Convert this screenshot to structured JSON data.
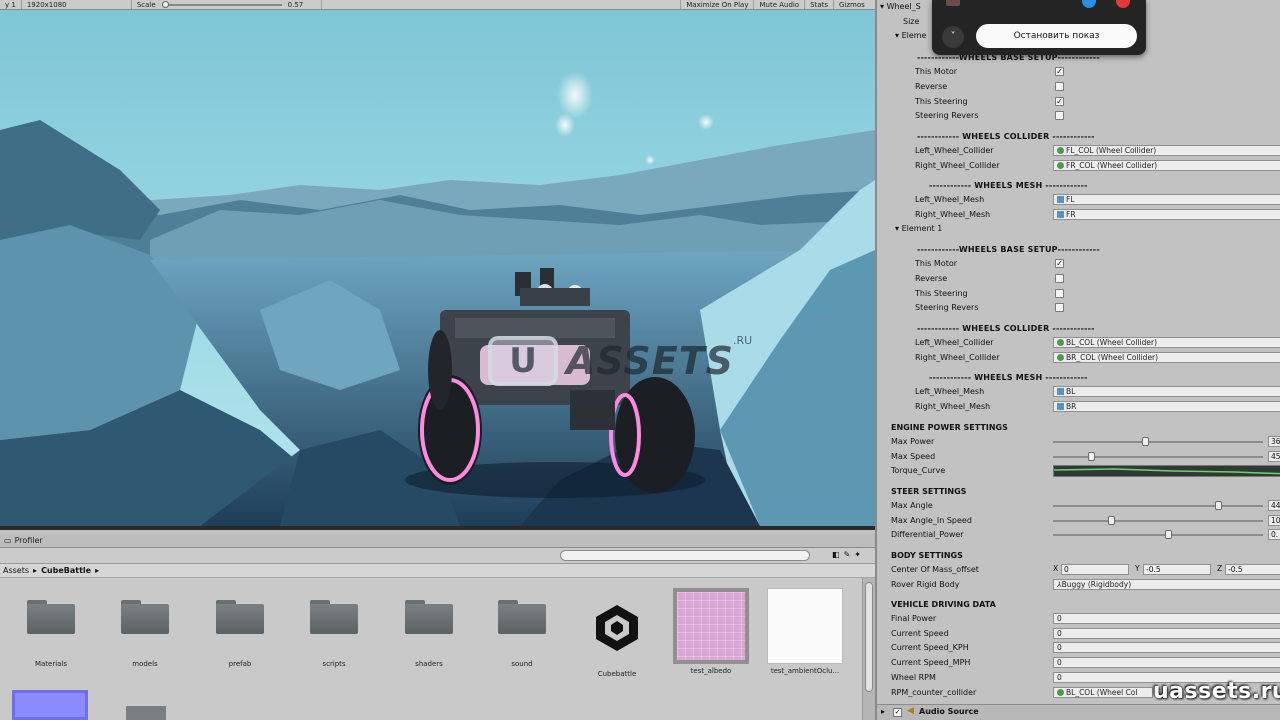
{
  "game_toolbar": {
    "display": "y 1",
    "resolution": "1920x1080",
    "scale_label": "Scale",
    "scale_value": "0.57",
    "maximize_on_play": "Maximize On Play",
    "mute_audio": "Mute Audio",
    "stats": "Stats",
    "gizmos": "Gizmos"
  },
  "game_view": {
    "watermark_letter": "U",
    "watermark_text": "ASSETS",
    "watermark_suffix": ".RU"
  },
  "profiler_tab": "Profiler",
  "project": {
    "breadcrumb_root": "Assets",
    "breadcrumb_sep": "▸",
    "breadcrumb_current": "CubeBattle",
    "assets": [
      {
        "label": "Materials",
        "kind": "folder"
      },
      {
        "label": "models",
        "kind": "folder"
      },
      {
        "label": "prefab",
        "kind": "folder"
      },
      {
        "label": "scripts",
        "kind": "folder"
      },
      {
        "label": "shaders",
        "kind": "folder"
      },
      {
        "label": "sound",
        "kind": "folder"
      },
      {
        "label": "Cubebattle",
        "kind": "unity-scene"
      },
      {
        "label": "test_albedo",
        "kind": "texture-pink"
      },
      {
        "label": "test_ambientOclu...",
        "kind": "texture-white"
      }
    ]
  },
  "inspector": {
    "top_label": "Wheel_S",
    "size_label": "Size",
    "element_label": "Eleme",
    "element1_label": "Element 1",
    "wheels_base_setup": "WHEELS BASE SETUP",
    "this_motor": "This Motor",
    "reverse": "Reverse",
    "this_steering": "This Steering",
    "steering_revers": "Steering Revers",
    "wheels_collider": "WHEELS COLLIDER",
    "left_wheel_collider": "Left_Wheel_Collider",
    "right_wheel_collider": "Right_Wheel_Collider",
    "wheels_mesh": "WHEELS MESH",
    "left_wheel_mesh": "Left_Wheel_Mesh",
    "right_wheel_mesh": "Right_Wheel_Mesh",
    "e0": {
      "this_motor": true,
      "reverse": false,
      "this_steering": true,
      "steering_revers": false,
      "left_collider": "FL_COL (Wheel Collider)",
      "right_collider": "FR_COL (Wheel Collider)",
      "left_mesh": "FL",
      "right_mesh": "FR"
    },
    "e1": {
      "this_motor": true,
      "reverse": false,
      "this_steering": false,
      "steering_revers": false,
      "left_collider": "BL_COL (Wheel Collider)",
      "right_collider": "BR_COL (Wheel Collider)",
      "left_mesh": "BL",
      "right_mesh": "BR"
    },
    "engine_power_settings": "ENGINE POWER SETTINGS",
    "max_power": "Max Power",
    "max_power_val": "36",
    "max_power_pos": 0.44,
    "max_speed": "Max Speed",
    "max_speed_val": "45",
    "max_speed_pos": 0.17,
    "torque_curve": "Torque_Curve",
    "steer_settings": "STEER SETTINGS",
    "max_angle": "Max Angle",
    "max_angle_val": "44",
    "max_angle_pos": 0.8,
    "max_angle_speed": "Max Angle_In Speed",
    "max_angle_speed_val": "10",
    "max_angle_speed_pos": 0.27,
    "differential_power": "Differential_Power",
    "differential_power_val": "0.",
    "differential_power_pos": 0.55,
    "body_settings": "BODY SETTINGS",
    "center_of_mass": "Center Of Mass_offset",
    "com_x_label": "X",
    "com_x": "0",
    "com_y_label": "Y",
    "com_y": "-0.5",
    "com_z_label": "Z",
    "com_z": "-0.5",
    "rover_rigid_body": "Rover Rigid Body",
    "rover_rigid_body_val": "Buggy (Rigidbody)",
    "vehicle_driving_data": "VEHICLE DRIVING DATA",
    "final_power": "Final Power",
    "final_power_val": "0",
    "current_speed": "Current Speed",
    "current_speed_val": "0",
    "current_speed_kph": "Current Speed_KPH",
    "current_speed_kph_val": "0",
    "current_speed_mph": "Current Speed_MPH",
    "current_speed_mph_val": "0",
    "wheel_rpm": "Wheel RPM",
    "wheel_rpm_val": "0",
    "rpm_counter_collider": "RPM_counter_collider",
    "rpm_counter_collider_val": "BL_COL (Wheel Col",
    "audio_source": "Audio Source"
  },
  "share_overlay": {
    "chevron": "˅",
    "stop_label": "Остановить показ"
  },
  "site_watermark": "uassets.ru",
  "colors": {
    "inspector_bg": "#c2c2c2",
    "share_bg": "#242424",
    "sky": "#8fd0dd",
    "ice": "#5f97b2",
    "rover_glow": "#ff7ad9"
  }
}
